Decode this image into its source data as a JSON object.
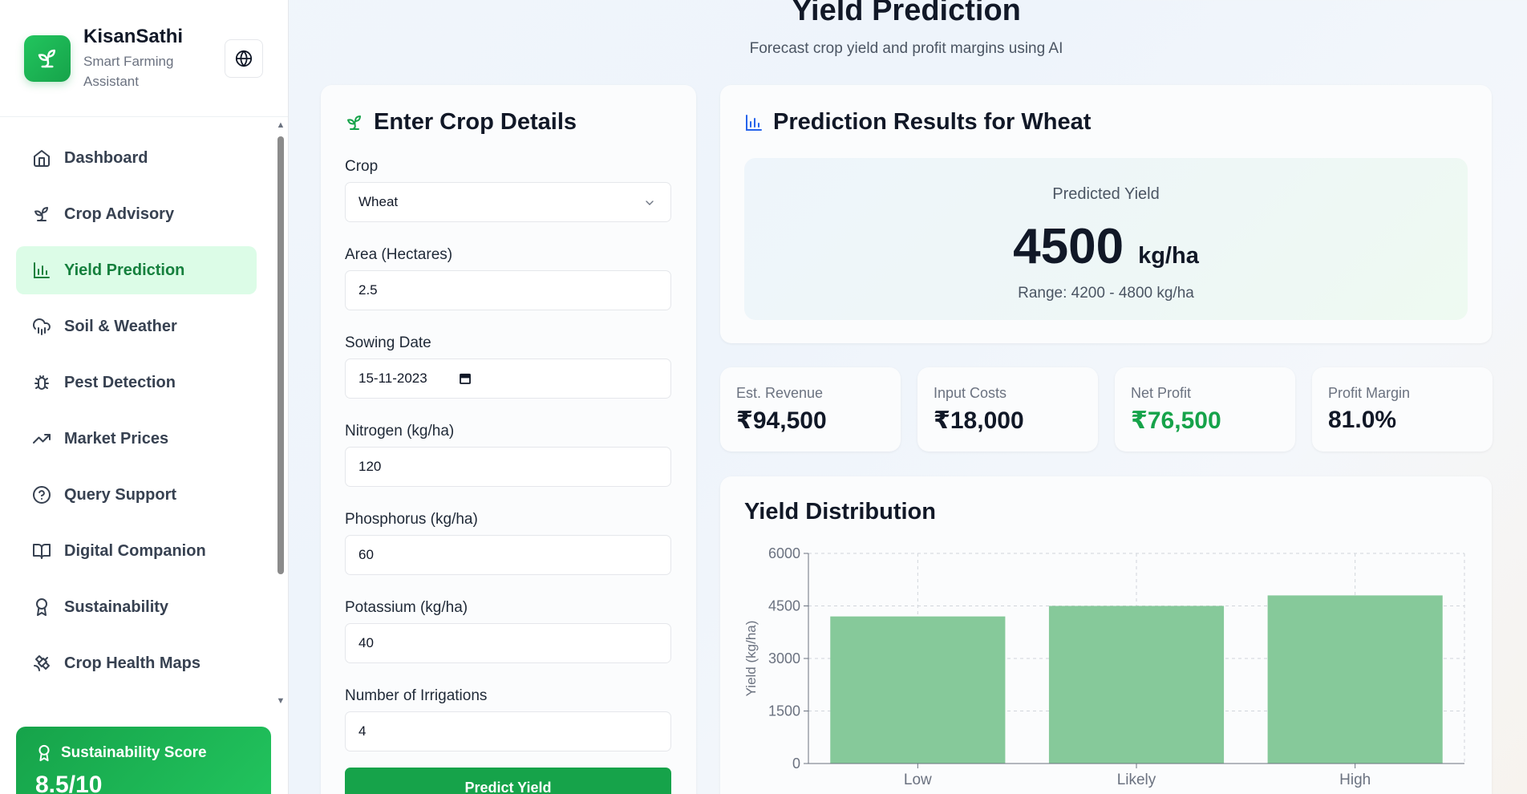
{
  "brand": {
    "title": "KisanSathi",
    "subtitle": "Smart Farming Assistant"
  },
  "sidebar": {
    "items": [
      {
        "label": "Dashboard",
        "icon": "home-icon"
      },
      {
        "label": "Crop Advisory",
        "icon": "sprout-icon"
      },
      {
        "label": "Yield Prediction",
        "icon": "bar-chart-icon",
        "active": true
      },
      {
        "label": "Soil & Weather",
        "icon": "cloud-rain-icon"
      },
      {
        "label": "Pest Detection",
        "icon": "bug-icon"
      },
      {
        "label": "Market Prices",
        "icon": "trending-up-icon"
      },
      {
        "label": "Query Support",
        "icon": "help-circle-icon"
      },
      {
        "label": "Digital Companion",
        "icon": "book-open-icon"
      },
      {
        "label": "Sustainability",
        "icon": "award-icon"
      },
      {
        "label": "Crop Health Maps",
        "icon": "satellite-icon"
      }
    ],
    "sustainability": {
      "title": "Sustainability Score",
      "score": "8.5/10"
    }
  },
  "header": {
    "title": "Yield Prediction",
    "subtitle": "Forecast crop yield and profit margins using AI"
  },
  "form": {
    "title": "Enter Crop Details",
    "fields": [
      {
        "label": "Crop",
        "value": "Wheat",
        "type": "select"
      },
      {
        "label": "Area (Hectares)",
        "value": "2.5"
      },
      {
        "label": "Sowing Date",
        "value": "15-11-2023",
        "type": "date"
      },
      {
        "label": "Nitrogen (kg/ha)",
        "value": "120"
      },
      {
        "label": "Phosphorus (kg/ha)",
        "value": "60"
      },
      {
        "label": "Potassium (kg/ha)",
        "value": "40"
      },
      {
        "label": "Number of Irrigations",
        "value": "4"
      }
    ],
    "submit_label": "Predict Yield"
  },
  "results": {
    "title": "Prediction Results for Wheat",
    "predicted_label": "Predicted Yield",
    "predicted_value": "4500",
    "predicted_unit": "kg/ha",
    "range": "Range: 4200 - 4800 kg/ha",
    "stats": [
      {
        "label": "Est. Revenue",
        "value": "₹94,500"
      },
      {
        "label": "Input Costs",
        "value": "₹18,000"
      },
      {
        "label": "Net Profit",
        "value": "₹76,500",
        "highlight": true
      },
      {
        "label": "Profit Margin",
        "value": "81.0%"
      }
    ]
  },
  "colors": {
    "accent": "#16a34a",
    "active_bg": "#dcfce7",
    "bar": "#86c99a"
  },
  "chart_data": {
    "type": "bar",
    "title": "Yield Distribution",
    "categories": [
      "Low",
      "Likely",
      "High"
    ],
    "values": [
      4200,
      4500,
      4800
    ],
    "ylabel": "Yield (kg/ha)",
    "xlabel": "",
    "ylim": [
      0,
      6000
    ],
    "yticks": [
      0,
      1500,
      3000,
      4500,
      6000
    ],
    "grid": true
  }
}
